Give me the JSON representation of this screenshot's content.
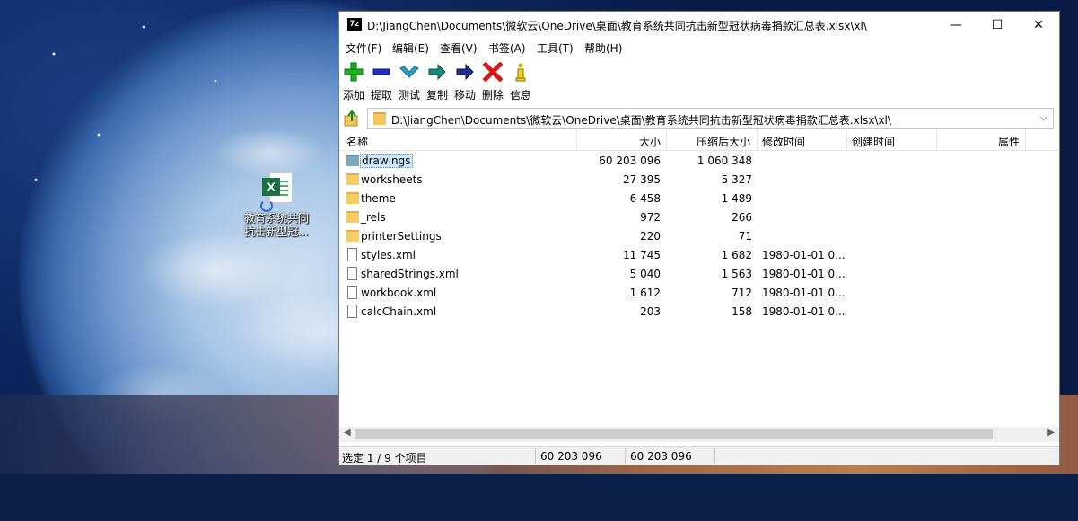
{
  "desktop": {
    "file_icon_label": "教育系统共同抗击新型冠..."
  },
  "window": {
    "app_icon": "7z",
    "title": "D:\\JiangChen\\Documents\\微软云\\OneDrive\\桌面\\教育系统共同抗击新型冠状病毒捐款汇总表.xlsx\\xl\\",
    "minimize_glyph": "—",
    "maximize_glyph": "☐",
    "close_glyph": "✕"
  },
  "menu": [
    {
      "label": "文件(F)"
    },
    {
      "label": "编辑(E)"
    },
    {
      "label": "查看(V)"
    },
    {
      "label": "书签(A)"
    },
    {
      "label": "工具(T)"
    },
    {
      "label": "帮助(H)"
    }
  ],
  "toolbar": [
    {
      "label": "添加",
      "icon": "plus-icon",
      "color": "#1db31d"
    },
    {
      "label": "提取",
      "icon": "minus-icon",
      "color": "#1f2fc7"
    },
    {
      "label": "测试",
      "icon": "check-icon",
      "color": "#2aa5c7"
    },
    {
      "label": "复制",
      "icon": "copy-arrow-icon",
      "color": "#16897a"
    },
    {
      "label": "移动",
      "icon": "move-arrow-icon",
      "color": "#1c2f8a"
    },
    {
      "label": "删除",
      "icon": "delete-x-icon",
      "color": "#d21a1a"
    },
    {
      "label": "信息",
      "icon": "info-icon",
      "color": "#c9a800"
    }
  ],
  "address": {
    "path": "D:\\JiangChen\\Documents\\微软云\\OneDrive\\桌面\\教育系统共同抗击新型冠状病毒捐款汇总表.xlsx\\xl\\"
  },
  "columns": {
    "name": "名称",
    "size": "大小",
    "packed": "压缩后大小",
    "modified": "修改时间",
    "created": "创建时间",
    "attributes": "属性"
  },
  "rows": [
    {
      "name": "drawings",
      "type": "folder",
      "size": "60 203 096",
      "packed": "1 060 348",
      "modified": "",
      "selected": true
    },
    {
      "name": "worksheets",
      "type": "folder",
      "size": "27 395",
      "packed": "5 327",
      "modified": ""
    },
    {
      "name": "theme",
      "type": "folder",
      "size": "6 458",
      "packed": "1 489",
      "modified": ""
    },
    {
      "name": "_rels",
      "type": "folder",
      "size": "972",
      "packed": "266",
      "modified": ""
    },
    {
      "name": "printerSettings",
      "type": "folder",
      "size": "220",
      "packed": "71",
      "modified": ""
    },
    {
      "name": "styles.xml",
      "type": "file",
      "size": "11 745",
      "packed": "1 682",
      "modified": "1980-01-01 0..."
    },
    {
      "name": "sharedStrings.xml",
      "type": "file",
      "size": "5 040",
      "packed": "1 563",
      "modified": "1980-01-01 0..."
    },
    {
      "name": "workbook.xml",
      "type": "file",
      "size": "1 612",
      "packed": "712",
      "modified": "1980-01-01 0..."
    },
    {
      "name": "calcChain.xml",
      "type": "file",
      "size": "203",
      "packed": "158",
      "modified": "1980-01-01 0..."
    }
  ],
  "status": {
    "selection": "选定 1 / 9 个项目",
    "size": "60 203 096",
    "total": "60 203 096"
  }
}
